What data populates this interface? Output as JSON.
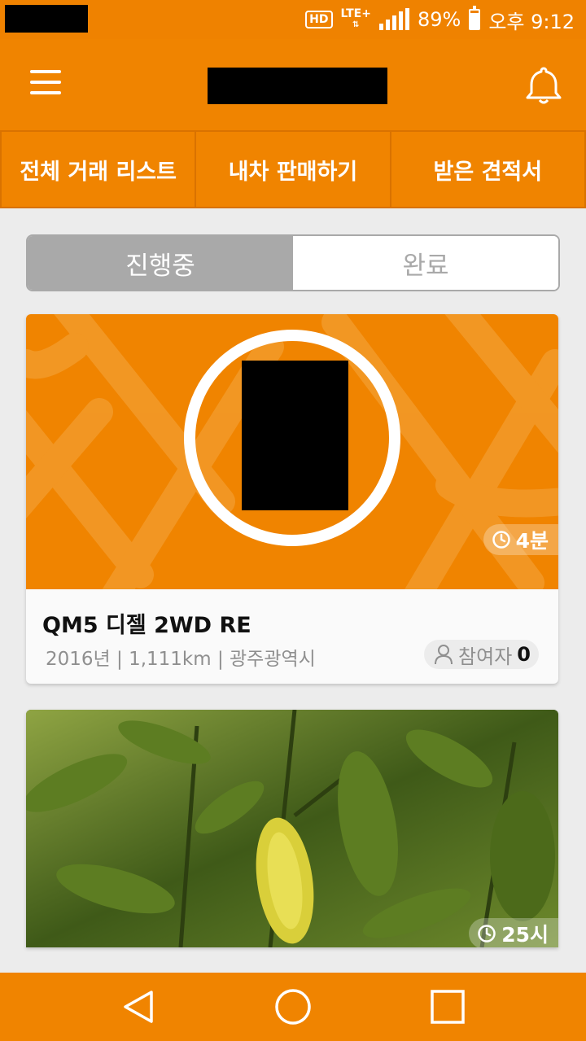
{
  "status_bar": {
    "hd_label": "HD",
    "network_label": "LTE+",
    "battery": "89%",
    "time": "오후 9:12"
  },
  "topnav": {
    "items": [
      "전체 거래 리스트",
      "내차 판매하기",
      "받은 견적서"
    ]
  },
  "segment": {
    "active_label": "진행중",
    "inactive_label": "완료"
  },
  "cards": [
    {
      "time_label": "4분",
      "title": "QM5 디젤 2WD RE",
      "meta": "2016년 | 1,111km | 광주광역시",
      "participants_label": "참여자",
      "participants_count": "0"
    },
    {
      "time_label": "25시"
    }
  ],
  "colors": {
    "primary": "#f08400",
    "segment_active": "#a9a9a9",
    "background": "#ececec"
  },
  "icons": [
    "menu-icon",
    "bell-icon",
    "clock-icon",
    "person-icon",
    "back-icon",
    "home-icon",
    "recents-icon"
  ]
}
